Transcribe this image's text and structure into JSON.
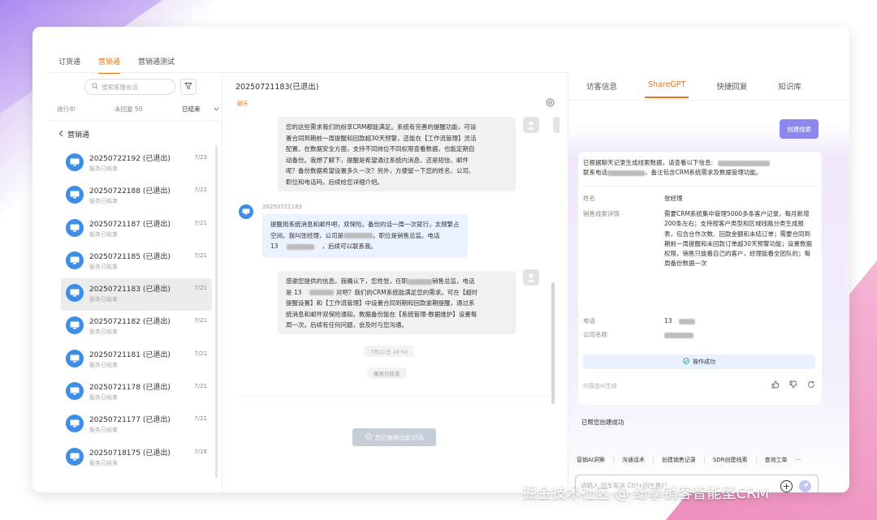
{
  "top_tabs": [
    "订货通",
    "营销通",
    "营销通测试"
  ],
  "search": {
    "placeholder": "搜索客服会话"
  },
  "status_tabs": [
    "进行中",
    "未回复 50",
    "已结束"
  ],
  "group_title": "营销通",
  "conversations": [
    {
      "title": "20250722192 (已退出)",
      "sub": "服务已结束",
      "date": "7/23"
    },
    {
      "title": "20250722188 (已退出)",
      "sub": "服务已结束",
      "date": "7/22"
    },
    {
      "title": "20250721187 (已退出)",
      "sub": "服务已结束",
      "date": "7/21"
    },
    {
      "title": "20250721185 (已退出)",
      "sub": "服务已结束",
      "date": "7/21"
    },
    {
      "title": "20250721183 (已退出)",
      "sub": "服务已结束",
      "date": "7/21"
    },
    {
      "title": "20250721182 (已退出)",
      "sub": "服务已结束",
      "date": "7/21"
    },
    {
      "title": "20250721181 (已退出)",
      "sub": "服务已结束",
      "date": "7/21"
    },
    {
      "title": "20250721178 (已退出)",
      "sub": "服务已结束",
      "date": "7/21"
    },
    {
      "title": "20250721177 (已退出)",
      "sub": "服务已结束",
      "date": "7/21"
    },
    {
      "title": "20250718175 (已退出)",
      "sub": "服务已结束",
      "date": "7/18"
    }
  ],
  "chat": {
    "title": "20250721183(已退出)",
    "tag": "聊天",
    "msg1": [
      "您的这些需求我们的纷享CRM都能满足。系统有完善的提醒功能，可设",
      "置合同到期前一周提醒和回款超30天预警，还能在【工作流管理】灵活",
      "配置。在数据安全方面，支持不同岗位不同权限查看数据，也能定期自",
      "动备份。我想了解下，提醒是希望通过系统内消息、还是短信、邮件",
      "呢？备份数据希望设置多久一次？另外，方便留一下您的姓名、公司、",
      "职位和电话吗，后续给您详细介绍。"
    ],
    "customer_id": "20250721183",
    "msg2": [
      "提醒用系统消息和邮件吧，双保险。备份的话一周一次就行，太频繁占",
      "空间。我叫张经理，公司是",
      "，职位是销售总监。电话",
      "13",
      "，后续可以联系我。"
    ],
    "msg3": [
      "感谢您提供的信息。我确认下，您姓张，任职",
      "销售总监，电话",
      "是 13",
      " 对吧？我们的CRM系统能满足您的需求。可在【超时",
      "提醒设置】和【工作流管理】中设置合同到期和回款逾期提醒，通过系",
      "统消息和邮件双保险通知。数据备份能在【系统管理-数据维护】设置每",
      "周一次。后续有任何问题，会及时与您沟通。"
    ],
    "sys_time": "7月21日 16:50",
    "sys_ended": "服务已结束",
    "exit_banner": "您已被移出此对话"
  },
  "right": {
    "tabs": [
      "访客信息",
      "ShareGPT",
      "快捷回复",
      "知识库"
    ],
    "create_button": "创建线索",
    "intro_part1": "已根据聊天记录生成线索数据，请查看以下信息:",
    "intro_part2": "联系电话",
    "intro_part3": "，备注包含CRM系统需求及数据管理功能。",
    "fields": {
      "name_label": "姓名",
      "name_value": "张经理",
      "detail_label": "销售线索详情",
      "detail_value": "需要CRM系统集中管理5000多条客户记录，每月新增200条左右；支持按客户类型和区域线路分类生成报表，包含合作次数、回款金额和未结订单；需要合同到期前一周提醒和未回款订单超30天预警功能；设置数据权限，销售只能看自己的客户，经理能看全团队的；每周备份数据一次",
      "phone_label": "电话",
      "phone_value": "13",
      "company_label": "公司名称"
    },
    "op_success": "操作成功",
    "ai_generated": "内容由AI生成",
    "created_msg": "已帮您创建成功",
    "quick_actions": [
      "营销AI洞察",
      "沟通话术",
      "创建销售记录",
      "SDR创建线索",
      "查询工单",
      "···"
    ],
    "input_placeholder": "请输入 回车发送 Ctrl+回车换行"
  },
  "watermark": "掘金技术社区 @ 纷享销客智能型CRM"
}
